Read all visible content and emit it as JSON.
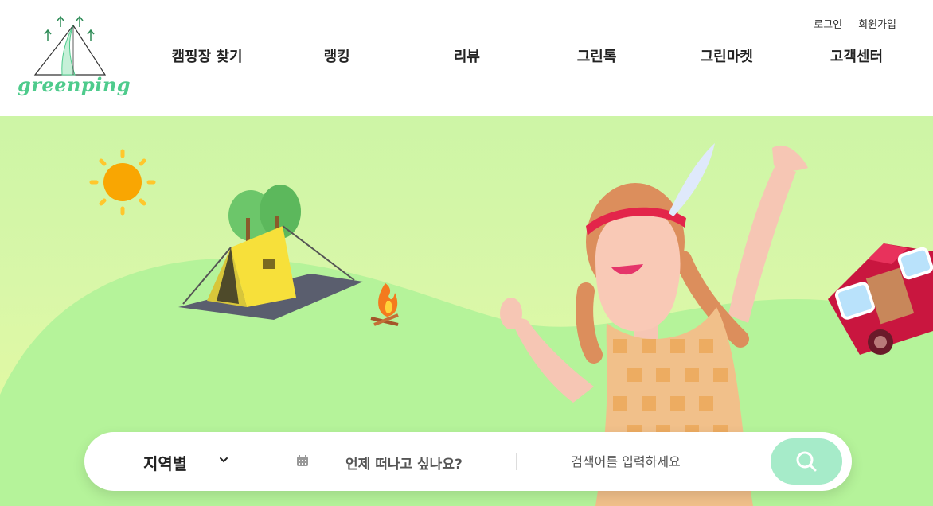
{
  "brand": {
    "name": "greenping"
  },
  "util_links": {
    "login": "로그인",
    "signup": "회원가입"
  },
  "nav": [
    {
      "label": "캠핑장 찾기"
    },
    {
      "label": "랭킹"
    },
    {
      "label": "리뷰"
    },
    {
      "label": "그린톡"
    },
    {
      "label": "그린마켓"
    },
    {
      "label": "고객센터"
    }
  ],
  "search": {
    "region_label": "지역별",
    "date_label": "언제 떠나고 싶나요?",
    "keyword_placeholder": "검색어를 입력하세요"
  },
  "icons": [
    "chevron-down-icon",
    "calendar-icon",
    "search-icon"
  ],
  "colors": {
    "brand_green": "#4ecb8c",
    "search_button": "#a6ebc9",
    "hero_bg": "#d9f7a8"
  }
}
